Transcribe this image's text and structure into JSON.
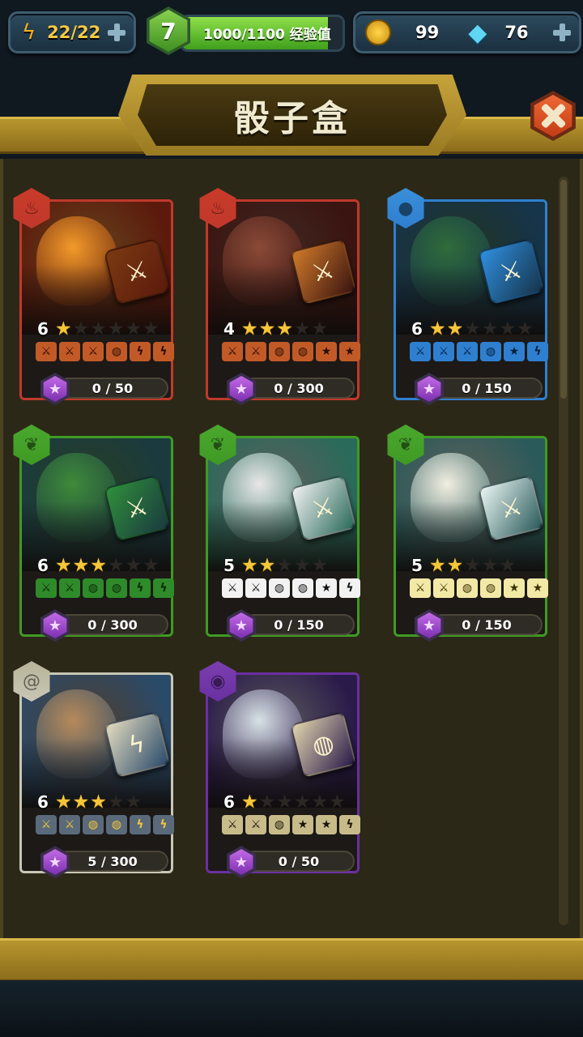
{
  "hud": {
    "energy": "22/22",
    "level": "7",
    "xp_text": "1000/1100 经验值",
    "xp_fraction": 0.909,
    "coins": "99",
    "gems": "76"
  },
  "title": "骰子盒",
  "cards": [
    {
      "name": "fire-demon",
      "element": "fire",
      "element_color": "#c93a2a",
      "frame_color": "#c0392b",
      "art_bg": "#5c1a0c",
      "monster_color": "#f29a2a",
      "die_color": "#7a3a12",
      "die_glyph": "⚔",
      "face_color": "#c25a28",
      "face_text_color": "#2a0e04",
      "level": "6",
      "stars_filled": 1,
      "stars_total": 6,
      "faces": [
        "⚔",
        "⚔",
        "⚔",
        "◍",
        "ϟ",
        "ϟ"
      ],
      "progress": "0 / 50"
    },
    {
      "name": "fire-bat",
      "element": "fire",
      "element_color": "#c93a2a",
      "frame_color": "#c0392b",
      "art_bg": "#3a1410",
      "monster_color": "#8a4a38",
      "die_color": "#d07a2a",
      "die_glyph": "⚔",
      "face_color": "#c25a28",
      "face_text_color": "#2a0e04",
      "level": "4",
      "stars_filled": 3,
      "stars_total": 5,
      "faces": [
        "⚔",
        "⚔",
        "◍",
        "◍",
        "★",
        "★"
      ],
      "progress": "0 / 300"
    },
    {
      "name": "water-serpent",
      "element": "water",
      "element_color": "#3a8fd8",
      "frame_color": "#2f7fd0",
      "art_bg": "#16344a",
      "monster_color": "#2f6b3a",
      "die_color": "#2f8fe0",
      "die_glyph": "⚔",
      "face_color": "#2f7fd0",
      "face_text_color": "#04203a",
      "level": "6",
      "stars_filled": 2,
      "stars_total": 6,
      "faces": [
        "⚔",
        "⚔",
        "⚔",
        "◍",
        "★",
        "ϟ"
      ],
      "progress": "0 / 150"
    },
    {
      "name": "nature-hydra",
      "element": "nature",
      "element_color": "#4aa82e",
      "frame_color": "#3f9a24",
      "art_bg": "#1a3a40",
      "monster_color": "#3f8a3a",
      "die_color": "#2f8f3a",
      "die_glyph": "⚔",
      "face_color": "#2f8a2a",
      "face_text_color": "#0a2a06",
      "level": "6",
      "stars_filled": 3,
      "stars_total": 6,
      "faces": [
        "⚔",
        "⚔",
        "◍",
        "◍",
        "ϟ",
        "ϟ"
      ],
      "progress": "0 / 300"
    },
    {
      "name": "nature-panda",
      "element": "nature",
      "element_color": "#4aa82e",
      "frame_color": "#3f9a24",
      "art_bg": "#2a6a5a",
      "monster_color": "#e8e8e8",
      "die_color": "#f2f2f2",
      "die_glyph": "⚔",
      "face_color": "#f2f2f2",
      "face_text_color": "#111111",
      "level": "5",
      "stars_filled": 2,
      "stars_total": 5,
      "faces": [
        "⚔",
        "⚔",
        "◍",
        "◍",
        "★",
        "ϟ"
      ],
      "progress": "0 / 150"
    },
    {
      "name": "nature-unicorn",
      "element": "nature",
      "element_color": "#4aa82e",
      "frame_color": "#3f9a24",
      "art_bg": "#2a5a5a",
      "monster_color": "#f3efe2",
      "die_color": "#eaf6f4",
      "die_glyph": "⚔",
      "face_color": "#f3e9a6",
      "face_text_color": "#3a3000",
      "level": "5",
      "stars_filled": 2,
      "stars_total": 5,
      "faces": [
        "⚔",
        "⚔",
        "◍",
        "◍",
        "★",
        "★"
      ],
      "progress": "0 / 150"
    },
    {
      "name": "wind-wizard",
      "element": "wind",
      "element_color": "#b8b49a",
      "frame_color": "#c8c6b4",
      "art_bg": "#2a4a6a",
      "monster_color": "#b68a5a",
      "die_color": "#e4dcc0",
      "die_glyph": "ϟ",
      "face_color": "#5a6a7a",
      "face_text_color": "#f6c63a",
      "level": "6",
      "stars_filled": 3,
      "stars_total": 5,
      "faces": [
        "⚔",
        "⚔",
        "◍",
        "◍",
        "ϟ",
        "ϟ"
      ],
      "progress": "5 / 300"
    },
    {
      "name": "arcane-skeleton",
      "element": "arcane",
      "element_color": "#7b3fb0",
      "frame_color": "#6a2fa0",
      "art_bg": "#2a1a4a",
      "monster_color": "#d8e2e6",
      "die_color": "#e2d6ae",
      "die_glyph": "◍",
      "face_color": "#c8bb8a",
      "face_text_color": "#1a1408",
      "level": "6",
      "stars_filled": 1,
      "stars_total": 6,
      "faces": [
        "⚔",
        "⚔",
        "◍",
        "★",
        "★",
        "ϟ"
      ],
      "progress": "0 / 50"
    }
  ]
}
